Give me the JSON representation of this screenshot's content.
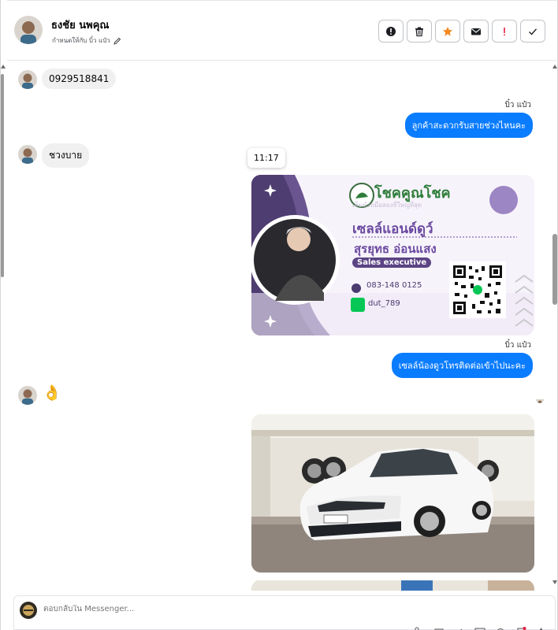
{
  "header": {
    "contact_name": "ธงชัย นพคุณ",
    "assigned_text": "กำหนดให้กับ บิ๋ว แป๋ว",
    "actions": [
      {
        "icon": "alert-circle-icon",
        "label": "mark-spam"
      },
      {
        "icon": "trash-icon",
        "label": "delete"
      },
      {
        "icon": "star-icon",
        "label": "star"
      },
      {
        "icon": "envelope-icon",
        "label": "mark-unread"
      },
      {
        "icon": "exclamation-icon",
        "label": "follow-up"
      },
      {
        "icon": "check-icon",
        "label": "done"
      }
    ]
  },
  "messages": {
    "m1": {
      "text": "0929518841"
    },
    "m2_sender": "บิ๋ว แป๋ว",
    "m2": {
      "text": "ลูกค้าสะดวกรับสายช่วงไหนคะ"
    },
    "m3": {
      "text": "ชวงบาย"
    },
    "tooltip_time": "11:17",
    "m4_sender": "บิ๋ว แป๋ว",
    "m4": {
      "text": "เซลล์น้องดูวโทรติดต่อเข้าไปนะคะ"
    },
    "m5_emoji": "👌"
  },
  "business_card": {
    "brand": "โชคคูณโชค",
    "tagline": "เต็นท์รถมือสองที่ใหญ่ที่สุด",
    "name_line1": "เซลล์แอนด์ดูว์",
    "name_line2": "สุรยุทธ อ่อนแสง",
    "role": "Sales executive",
    "phone": "083-148 0125",
    "line_id": "dut_789"
  },
  "car_photo": {
    "plate": "1ขต 1849"
  },
  "composer": {
    "placeholder": "ตอบกลับใน Messenger..."
  },
  "colors": {
    "outgoing_bubble": "#0a7cff",
    "incoming_bubble": "#f0f0f0",
    "star": "#f4891f",
    "exclamation": "#e41e3f",
    "card_purple": "#6b4aa0"
  }
}
